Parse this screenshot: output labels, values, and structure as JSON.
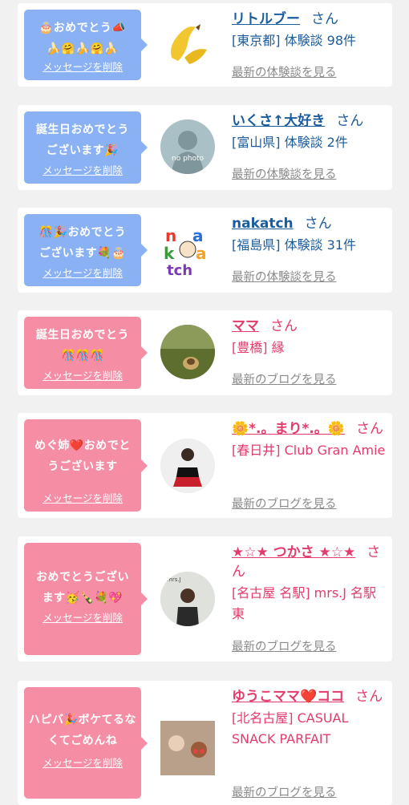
{
  "cards": [
    {
      "theme": "blue",
      "message": "🎂おめでとう📣\n🍌🤗🍌🤗🍌",
      "delete_label": "メッセージを削除",
      "name": "リトルブー",
      "san": "さん",
      "detail": "[東京都] 体験談 98件",
      "latest": "最新の体験談を見る"
    },
    {
      "theme": "blue",
      "message": "誕生日おめでとう\nございます🎉",
      "delete_label": "メッセージを削除",
      "name": "いくさ↑大好き",
      "san": "さん",
      "detail": "[富山県] 体験談 2件",
      "latest": "最新の体験談を見る",
      "avatar_text": "no photo"
    },
    {
      "theme": "blue",
      "message": "🎊🎉おめでとう\nございます💐🎂",
      "delete_label": "メッセージを削除",
      "name": "nakatch",
      "san": "さん",
      "detail": "[福島県] 体験談 31件",
      "latest": "最新の体験談を見る"
    },
    {
      "theme": "pink",
      "message": "誕生日おめでとう\n🎊🎊🎊",
      "delete_label": "メッセージを削除",
      "name": "ママ",
      "san": "さん",
      "detail": "[豊橋] 縁",
      "latest": "最新のブログを見る"
    },
    {
      "theme": "pink",
      "message": "めぐ姉❤️おめでと\nうございます",
      "delete_label": "メッセージを削除",
      "name": "🌼*.。まり*.。🌼",
      "san": "さん",
      "detail": "[春日井] Club Gran Amie",
      "latest": "最新のブログを見る"
    },
    {
      "theme": "pink",
      "message": "おめでとうござい\nます🥳🍾💐💖",
      "delete_label": "メッセージを削除",
      "name": "★☆★ つかさ ★☆★",
      "san": "さん",
      "detail": "[名古屋 名駅] mrs.J 名駅東",
      "latest": "最新のブログを見る"
    },
    {
      "theme": "pink",
      "message": "ハピバ🎉ボケてるな\nくてごめんね",
      "delete_label": "メッセージを削除",
      "name": "ゆうこママ❤️ココ",
      "san": "さん",
      "detail": "[北名古屋] CASUAL SNACK PARFAIT",
      "latest": "最新のブログを見る"
    }
  ],
  "colors": {
    "blue_bubble": "#89b1f4",
    "pink_bubble": "#f58ea5",
    "blue_text": "#1b5c9e",
    "pink_text": "#e33b6b",
    "muted": "#8a8a8a"
  },
  "icons": [
    "banana-icon",
    "no-photo-avatar",
    "nakatch-logo",
    "grass-photo",
    "woman-photo",
    "mrsj-photo",
    "kids-photo"
  ]
}
